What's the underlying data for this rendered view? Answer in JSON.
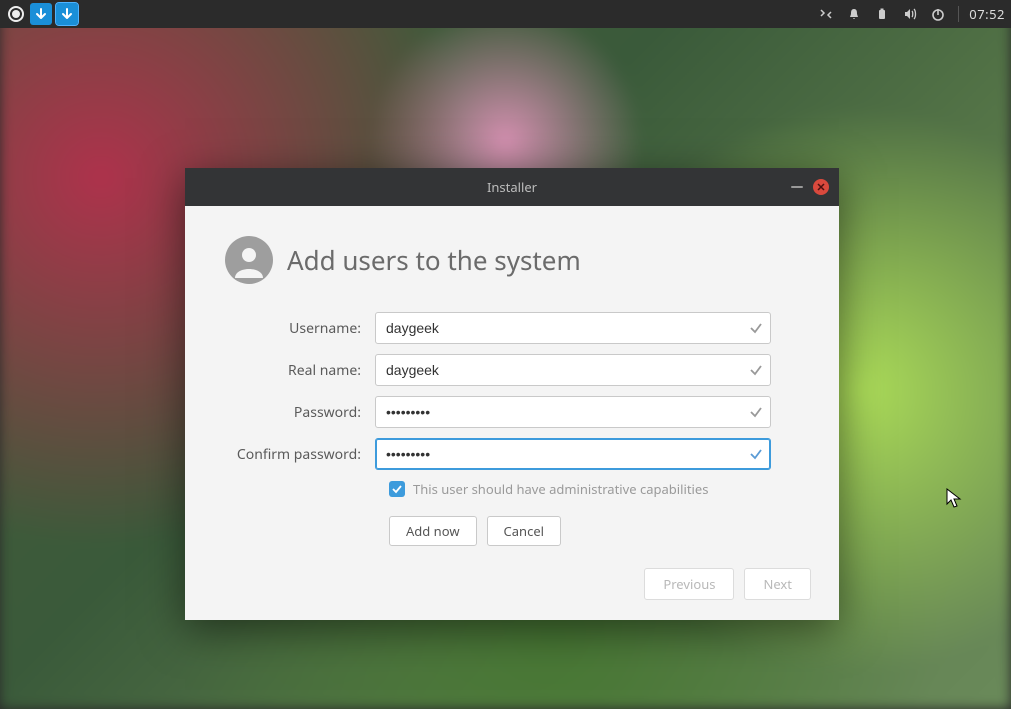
{
  "panel": {
    "clock": "07:52"
  },
  "dialog": {
    "title": "Installer",
    "heading": "Add users to the system",
    "labels": {
      "username": "Username:",
      "realname": "Real name:",
      "password": "Password:",
      "confirm": "Confirm password:"
    },
    "values": {
      "username": "daygeek",
      "realname": "daygeek",
      "password": "•••••••••",
      "confirm": "•••••••••"
    },
    "admin_checkbox": "This user should have administrative capabilities",
    "buttons": {
      "add": "Add now",
      "cancel": "Cancel",
      "previous": "Previous",
      "next": "Next"
    }
  }
}
